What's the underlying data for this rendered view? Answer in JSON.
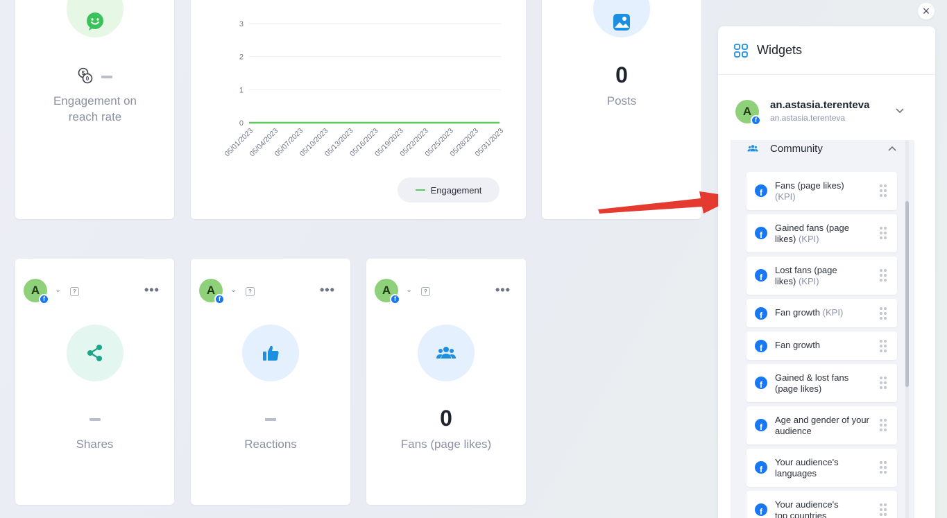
{
  "top_cards": {
    "engagement_rate": {
      "label": "Engagement on reach rate",
      "value": "—"
    },
    "posts": {
      "value": "0",
      "label": "Posts"
    }
  },
  "chart_data": {
    "type": "line",
    "x": [
      "05/01/2023",
      "05/04/2023",
      "05/07/2023",
      "05/10/2023",
      "05/13/2023",
      "05/16/2023",
      "05/19/2023",
      "05/22/2023",
      "05/25/2023",
      "05/28/2023",
      "05/31/2023"
    ],
    "y_ticks": [
      "0",
      "1",
      "2",
      "3"
    ],
    "ylim": [
      0,
      3
    ],
    "series": [
      {
        "name": "Engagement",
        "values": [
          0,
          0,
          0,
          0,
          0,
          0,
          0,
          0,
          0,
          0,
          0
        ],
        "color": "#5ec95a"
      }
    ],
    "legend_label": "Engagement",
    "legend": "bottom-right",
    "grid": true
  },
  "bottom_cards": [
    {
      "avatar": "A",
      "help": "?",
      "more": "•••",
      "value": "—",
      "label": "Shares",
      "icon": "share-icon"
    },
    {
      "avatar": "A",
      "help": "?",
      "more": "•••",
      "value": "—",
      "label": "Reactions",
      "icon": "thumbs-up-icon"
    },
    {
      "avatar": "A",
      "help": "?",
      "more": "•••",
      "value": "0",
      "label": "Fans (page likes)",
      "icon": "users-icon"
    }
  ],
  "panel": {
    "close": "×",
    "title": "Widgets",
    "account": {
      "avatar": "A",
      "name": "an.astasia.terenteva",
      "handle": "an.astasia.terenteva"
    },
    "section": "Community",
    "items": [
      {
        "text": "Fans (page likes)",
        "kpi": "(KPI)"
      },
      {
        "text": "Gained fans (page likes)",
        "kpi": "(KPI)"
      },
      {
        "text": "Lost fans (page likes)",
        "kpi": "(KPI)"
      },
      {
        "text": "Fan growth",
        "kpi": "(KPI)"
      },
      {
        "text": "Fan growth",
        "kpi": ""
      },
      {
        "text": "Gained & lost fans (page likes)",
        "kpi": ""
      },
      {
        "text": "Age and gender of your audience",
        "kpi": ""
      },
      {
        "text": "Your audience's languages",
        "kpi": ""
      },
      {
        "text": "Your audience's top countries",
        "kpi": ""
      }
    ]
  },
  "colors": {
    "accent_blue": "#1877f2",
    "arrow_red": "#e53a2f",
    "line_green": "#5ec95a"
  }
}
